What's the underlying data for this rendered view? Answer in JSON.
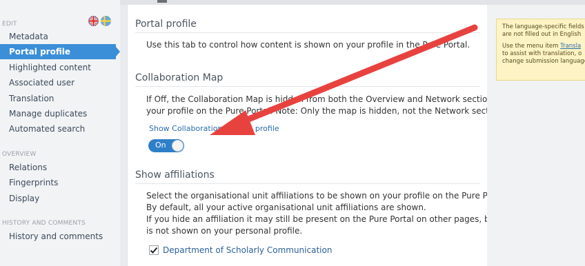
{
  "sidebar": {
    "edit_heading": "EDIT",
    "edit_items": [
      {
        "label": "Metadata",
        "active": false
      },
      {
        "label": "Portal profile",
        "active": true
      },
      {
        "label": "Highlighted content",
        "active": false
      },
      {
        "label": "Associated user",
        "active": false
      },
      {
        "label": "Translation",
        "active": false
      },
      {
        "label": "Manage duplicates",
        "active": false
      },
      {
        "label": "Automated search",
        "active": false
      }
    ],
    "overview_heading": "OVERVIEW",
    "overview_items": [
      {
        "label": "Relations"
      },
      {
        "label": "Fingerprints"
      },
      {
        "label": "Display"
      }
    ],
    "history_heading": "HISTORY AND COMMENTS",
    "history_items": [
      {
        "label": "History and comments"
      }
    ],
    "flags": [
      "uk-flag-icon",
      "sweden-flag-icon"
    ]
  },
  "main": {
    "portal_profile": {
      "title": "Portal profile",
      "text": "Use this tab to control how content is shown on your profile in the Pure Portal."
    },
    "collaboration_map": {
      "title": "Collaboration Map",
      "text_line1": "If Off, the Collaboration Map is hidden from both the Overview and Network sections of",
      "text_line2": "your profile on the Pure Portal. Note: Only the map is hidden, not the Network section.",
      "link": "Show Collaboration Map on profile",
      "toggle_label": "On"
    },
    "show_affiliations": {
      "title": "Show affiliations",
      "line1": "Select the organisational unit affiliations to be shown on your profile on the Pure Portal.",
      "line2": "By default, all your active organisational unit affiliations are shown.",
      "line3": "If you hide an affiliation it may still be present on the Pure Portal on other pages, but it",
      "line4": "is not shown on your personal profile.",
      "affiliation": "Department of Scholarly Communication",
      "affiliation_checked": true
    }
  },
  "help": {
    "line1": "The language-specific fields",
    "line2": "are not filled out in English",
    "line3_pre": "Use the menu item ",
    "line3_link": "Transla",
    "line4": "to assist with translation, o",
    "line5": "change submission language"
  },
  "colors": {
    "accent": "#3b8fd8",
    "annotation_arrow": "#e8423f",
    "help_bg": "#fdf3c4"
  }
}
